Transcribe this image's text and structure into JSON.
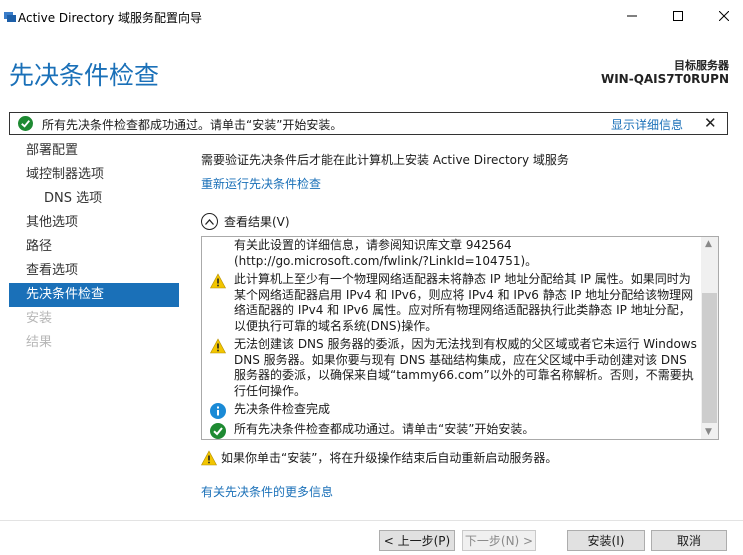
{
  "window": {
    "title": "Active Directory 域服务配置向导"
  },
  "header": {
    "page_title": "先决条件检查",
    "target_label": "目标服务器",
    "target_name": "WIN-QAIS7T0RUPN"
  },
  "banner": {
    "text": "所有先决条件检查都成功通过。请单击“安装”开始安装。",
    "details_link": "显示详细信息",
    "close": "✕"
  },
  "nav": [
    {
      "label": "部署配置",
      "state": "normal"
    },
    {
      "label": "域控制器选项",
      "state": "normal"
    },
    {
      "label": "DNS 选项",
      "state": "sub"
    },
    {
      "label": "其他选项",
      "state": "normal"
    },
    {
      "label": "路径",
      "state": "normal"
    },
    {
      "label": "查看选项",
      "state": "normal"
    },
    {
      "label": "先决条件检查",
      "state": "active"
    },
    {
      "label": "安装",
      "state": "disabled"
    },
    {
      "label": "结果",
      "state": "disabled"
    }
  ],
  "content": {
    "intro": "需要验证先决条件后才能在此计算机上安装 Active Directory 域服务",
    "rerun_link": "重新运行先决条件检查",
    "results_toggle": "查看结果(V)"
  },
  "results": [
    {
      "icon": "none",
      "text": "有关此设置的详细信息，请参阅知识库文章 942564 (http://go.microsoft.com/fwlink/?LinkId=104751)。"
    },
    {
      "icon": "warning",
      "text": "此计算机上至少有一个物理网络适配器未将静态 IP 地址分配给其 IP 属性。如果同时为某个网络适配器启用 IPv4 和 IPv6，则应将 IPv4 和 IPv6 静态 IP 地址分配给该物理网络适配器的 IPv4 和 IPv6 属性。应对所有物理网络适配器执行此类静态 IP 地址分配，以便执行可靠的域名系统(DNS)操作。"
    },
    {
      "icon": "warning",
      "text": "无法创建该 DNS 服务器的委派，因为无法找到有权威的父区域或者它未运行 Windows DNS 服务器。如果你要与现有 DNS 基础结构集成，应在父区域中手动创建对该 DNS 服务器的委派，以确保来自域“tammy66.com”以外的可靠名称解析。否则，不需要执行任何操作。"
    },
    {
      "icon": "info",
      "text": "先决条件检查完成"
    },
    {
      "icon": "success",
      "text": "所有先决条件检查都成功通过。请单击“安装”开始安装。"
    }
  ],
  "warning_note": "如果你单击“安装”，将在升级操作结束后自动重新启动服务器。",
  "more_link": "有关先决条件的更多信息",
  "buttons": {
    "prev": "< 上一步(P)",
    "next": "下一步(N) >",
    "install": "安装(I)",
    "cancel": "取消"
  },
  "colors": {
    "accent": "#1a70b8",
    "success": "#1e8a32",
    "warning": "#f2c500",
    "info": "#1a8ad6"
  }
}
